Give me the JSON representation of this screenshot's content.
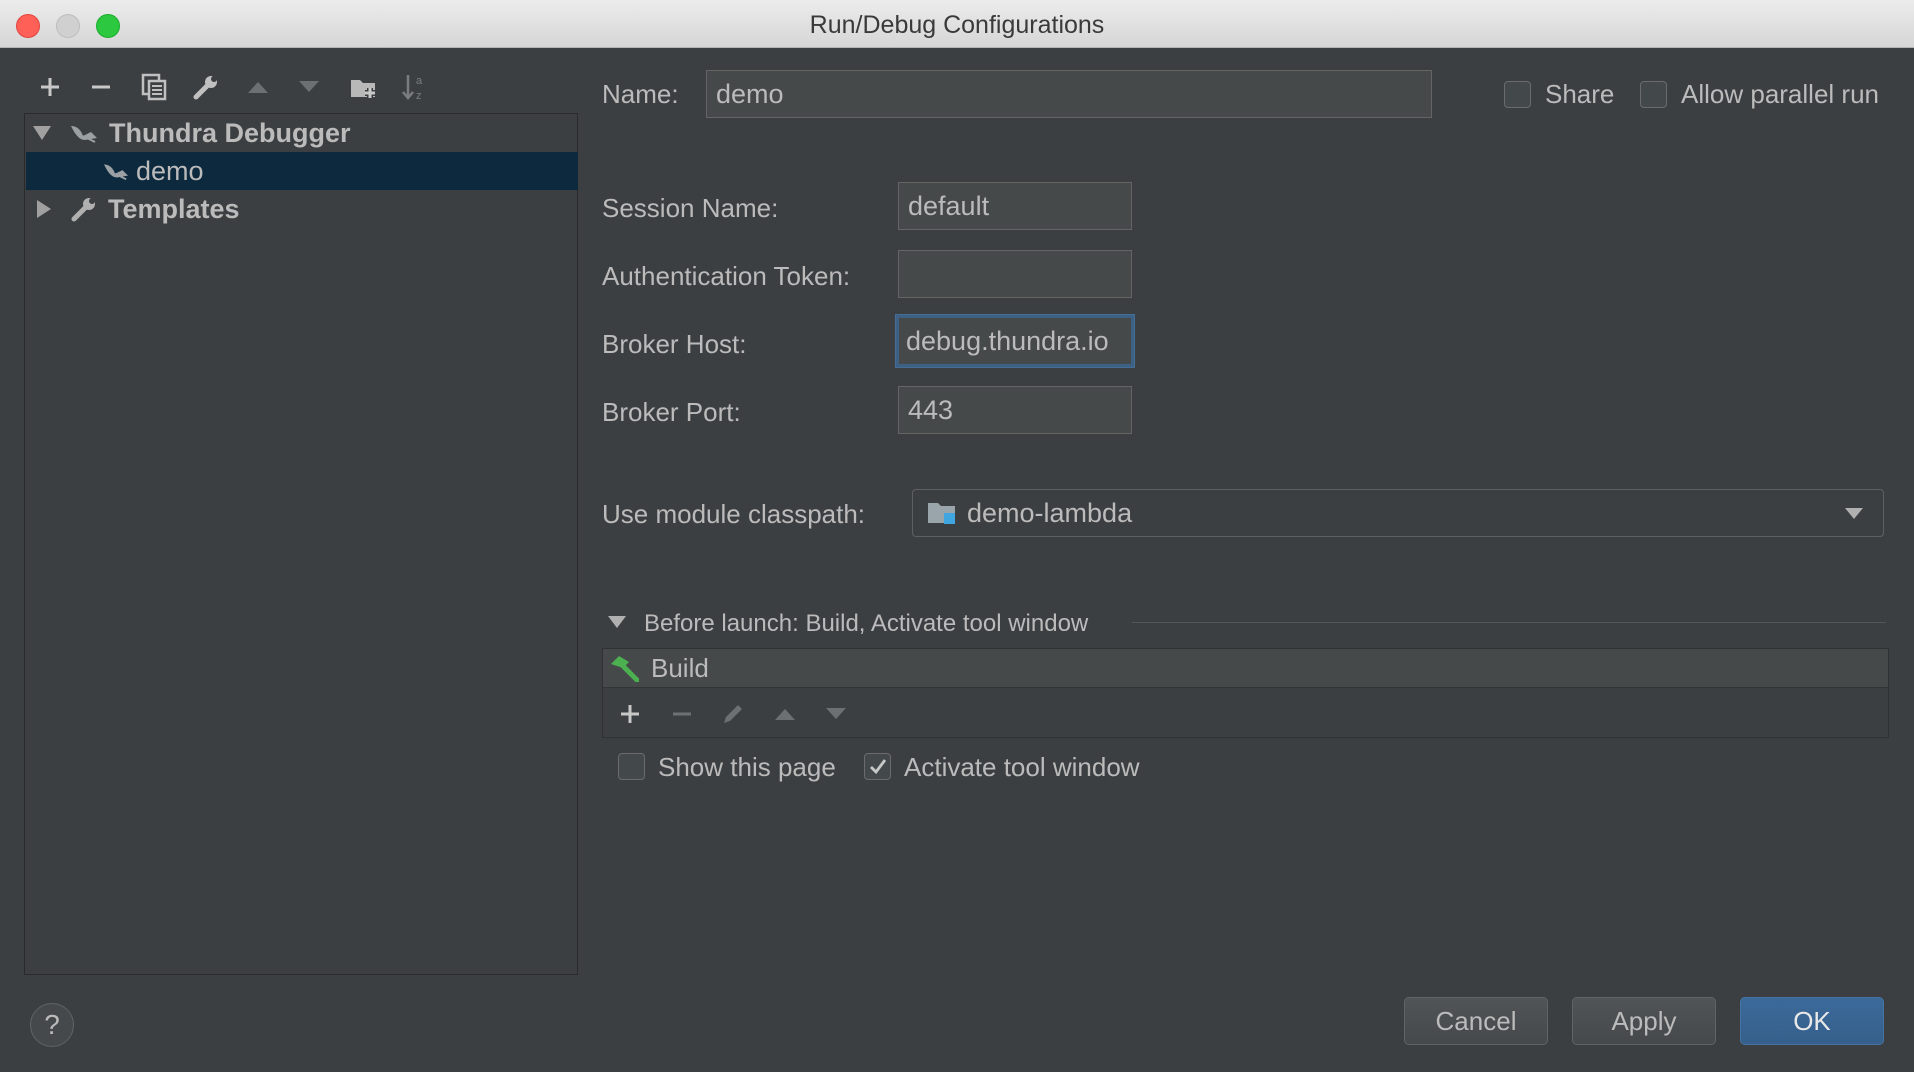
{
  "window": {
    "title": "Run/Debug Configurations"
  },
  "toolbar": {
    "icons": [
      "add-icon",
      "remove-icon",
      "copy-icon",
      "wrench-icon",
      "move-up-icon",
      "move-down-icon",
      "new-folder-icon",
      "sort-icon"
    ]
  },
  "tree": {
    "root_label": "Thundra Debugger",
    "child_label": "demo",
    "templates_label": "Templates"
  },
  "form": {
    "name_label": "Name:",
    "name_value": "demo",
    "share_label": "Share",
    "share_checked": false,
    "parallel_label": "Allow parallel run",
    "parallel_checked": false,
    "session_label": "Session Name:",
    "session_value": "default",
    "token_label": "Authentication Token:",
    "token_value": "",
    "host_label": "Broker Host:",
    "host_value": "debug.thundra.io",
    "port_label": "Broker Port:",
    "port_value": "443",
    "classpath_label": "Use module classpath:",
    "classpath_value": "demo-lambda"
  },
  "before_launch": {
    "header": "Before launch: Build, Activate tool window",
    "items": [
      "Build"
    ],
    "show_page_label": "Show this page",
    "show_page_checked": false,
    "activate_label": "Activate tool window",
    "activate_checked": true
  },
  "buttons": {
    "help_label": "?",
    "cancel_label": "Cancel",
    "apply_label": "Apply",
    "ok_label": "OK"
  },
  "colors": {
    "background": "#3c3f41",
    "selection": "#0d293e",
    "focus_border": "#3d6185",
    "primary_button": "#365f8b",
    "build_icon": "#4caf50"
  }
}
